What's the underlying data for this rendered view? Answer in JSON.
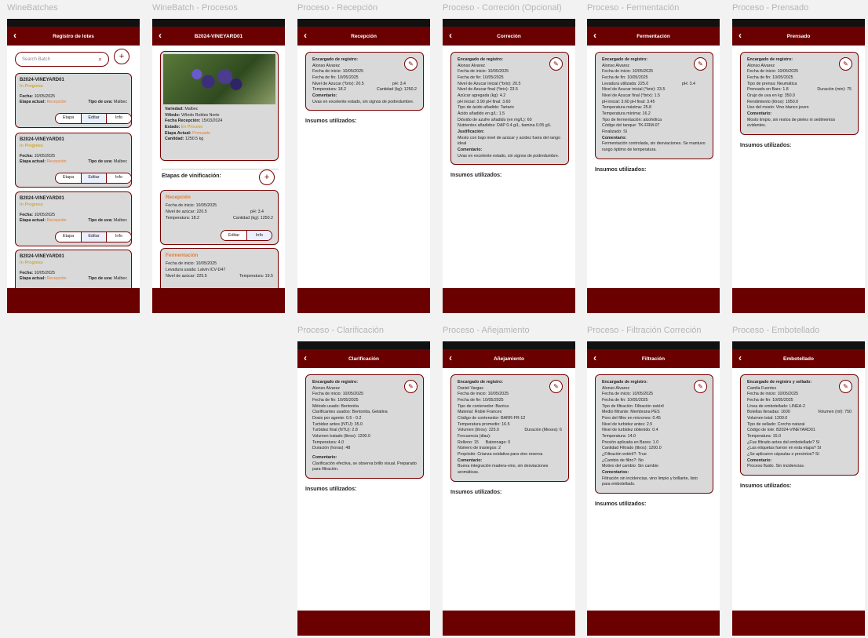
{
  "labels": {
    "l1": "WineBatches",
    "l2": "WineBatch - Procesos",
    "l3": "Proceso - Recepción",
    "l4": "Proceso - Correción (Opcional)",
    "l5": "Proceso - Fermentación",
    "l6": "Proceso - Prensado",
    "l7": "Proceso - Clarificación",
    "l8": "Proceso - Añejamiento",
    "l9": "Proceso - Filtración Correción",
    "l10": "Proceso - Embotellado"
  },
  "batches": {
    "title": "Registro de lotes",
    "search_placeholder": "Search Batch",
    "name": "B2024-VINEYARD01",
    "status": "In Progress",
    "fecha_label": "Fecha:",
    "fecha": "10/05/2025",
    "etapa_label": "Etapa actual:",
    "etapa": "Recepción",
    "uva_label": "Tipo de uva:",
    "uva": "Malbec",
    "btn_etapa": "Etapa",
    "btn_editar": "Editar",
    "btn_info": "Info"
  },
  "procesos": {
    "title": "B2024-VINEYARD01",
    "variedad_l": "Variedad:",
    "variedad": "Malbec",
    "vinedo_l": "Viñedo:",
    "vinedo": "Viñedo Robles Norte",
    "recepcion_l": "Fecha Recepción:",
    "recepcion": "15/03/2024",
    "estado_l": "Estado:",
    "estado": "En Proceso",
    "etapa_l": "Etapa Actual:",
    "etapa": "Prensado",
    "cantidad_l": "Cantidad:",
    "cantidad": "1250.5 kg",
    "etapas_title": "Etapas de vinificación:",
    "rec_title": "Recepción",
    "rec_fecha": "Fecha de inicio: 10/05/2025",
    "rec_azucar": "Nivel de azúcar: 220.5",
    "rec_ph": "pH: 3.4",
    "rec_temp": "Temperatura: 18.2",
    "rec_cant": "Cantidad (kg): 1250.2",
    "btn_editar": "Editar",
    "btn_info": "Info",
    "fer_title": "Fermentación",
    "fer_fecha": "Fecha de inicio: 10/05/2025",
    "fer_lev": "Levadura usada: Lalvin ICV-D47",
    "fer_azucar": "Nivel de azúcar: 225.5",
    "fer_temp": "Temperatura: 19.5"
  },
  "recepcion": {
    "title": "Recepción",
    "lines": [
      "Encargado de registro:",
      "Alonso Alvarez",
      "Fecha de inicio: 10/05/2025",
      "Fecha de fin: 10/05/2025"
    ],
    "azucar": "Nivel de Azucar (°brix): 20.5",
    "ph": "pH: 3.4",
    "temp": "Temperatura: 18.2",
    "cant": "Cantidad (kg): 1250.2",
    "com_l": "Comentario:",
    "com": "Uvas en excelente estado, sin signos de podredumbre.",
    "insumos": "Insumos utilizados:"
  },
  "correcion": {
    "title": "Correción",
    "lines": [
      "Encargado de registro:",
      "Alonso Alvarez",
      "Fecha de inicio: 10/05/2025",
      "Fecha de fin: 10/05/2025",
      "Nivel de Azucar inicial (°brix): 20.5",
      "Nivel de Azucar final (°brix): 23.5",
      "Azúcar agregada (kg): 4.2",
      "pH inicial: 3.90 pH final: 3.60",
      "Tipo de ácido añadido: Tartaric",
      "Ácido añadido en g/L: 1.5",
      "Dióxido de azufre añadido (en mg/L): 60",
      "Nutrientes añadidos: DAP 0.4 g/L, tiamina 0.05 g/L"
    ],
    "just_l": "Justificación:",
    "just": "Mosto con bajo nivel de azúcar y acidez fuera del rango ideal",
    "com_l": "Comentario:",
    "com": "Uvas en excelente estado, sin signos de podredumbre.",
    "insumos": "Insumos utilizados:"
  },
  "fermentacion": {
    "title": "Fermentación",
    "lines": [
      "Encargado de registro:",
      "Alonso Alvarez",
      "Fecha de inicio: 10/05/2025",
      "Fecha de fin: 10/05/2025"
    ],
    "lev": "Levadura utilizada: 225.0",
    "ph": "pH: 3.4",
    "lines2": [
      "Nivel de Azucar inicial (°brix): 23.5",
      "Nivel de Azucar final (°brix): 1.5",
      "pH inicial: 3.60 pH final: 3.45",
      "Temperatura máxima: 25.8",
      "Temperatura mínima: 16.2",
      "Tipo de fermentación: alcohólica",
      "Código del tanque: TK-FRM-07",
      "Finalizado: Sí"
    ],
    "com_l": "Comentario:",
    "com": "Fermentación controlada, sin desviaciones. Se mantuvo rango óptimo de temperatura.",
    "insumos": "Insumos utilizados:"
  },
  "prensado": {
    "title": "Prensado",
    "lines": [
      "Encargado de registro:",
      "Alonso Alvarez",
      "Fecha de inicio: 10/05/2025",
      "Fecha de fin: 10/05/2025",
      "Tipo de prensa: Neumática"
    ],
    "bar": "Prensado en Bars: 1.8",
    "dur": "Duración (min): 75",
    "lines2": [
      "Orujo de uva en kg: 350.0",
      "Rendimiento (litros): 1050.0",
      "Uso del mosto: Vino blanco joven"
    ],
    "com_l": "Comentario:",
    "com": "Mosto limpio, sin restos de pieles ni sedimentos evidentes.",
    "insumos": "Insumos utilizados:"
  },
  "clarificacion": {
    "title": "Clarificación",
    "lines": [
      "Encargado de registro:",
      "Alonso Alvarez",
      "Fecha de inicio: 10/05/2025",
      "Fecha de fin: 10/05/2025",
      "Método usado: Bentonita",
      "Clarificantes usados: Bentonita, Gelatina",
      "Dosis por agente: 0.5 - 0.2",
      "Turbidez antes (NTU): 35.0",
      "Turbidez final (NTU): 2.8",
      "Volumen tratado (litros): 1200.0",
      "Temperatura: 4.0",
      "Duración (horas): 48"
    ],
    "com_l": "Comentario:",
    "com": "Clarificación efectiva, se observa brillo visual. Preparado para filtración.",
    "insumos": "Insumos utilizados:"
  },
  "anejamiento": {
    "title": "Añejamiento",
    "lines": [
      "Encargado de registro:",
      "Daniel Vargas",
      "Fecha de inicio: 10/05/2025",
      "Fecha de fin: 10/05/2025",
      "Tipo de contenedor: Barrica",
      "Material: Roble Frances",
      "Código de contenedor: BARR-FR-12",
      "Temperatura promedio: 16.5"
    ],
    "vol": "Volumen (litros): 225.0",
    "dur": "Duración (Meses): 6",
    "freq": "Frecuencia (dias):",
    "rell": "Relleno: 15",
    "bat": "Batonnage: 0",
    "lines2": [
      "Número de trasiegos: 2",
      "Propósito: Crianza oxidativa para vino reserva"
    ],
    "com_l": "Comentario:",
    "com": "Buena integración madera-vino, sin desviaciones aromáticas.",
    "insumos": "Insumos utilizados:"
  },
  "filtracion": {
    "title": "Filtración",
    "lines": [
      "Encargado de registro:",
      "Alonso Alvarez",
      "Fecha de inicio: 10/05/2025",
      "Fecha de fin: 10/05/2025",
      "Tipo de filtración: Filtración estéril",
      "Medio filtrante: Membrana PES",
      "Poro del filtro en micrones: 0.45",
      "Nivel de turbidez antes: 2.5",
      "Nivel de turbidez obtenido: 0.4",
      "Temperatura: 14.0",
      "Presión aplicada en Bares: 1.0",
      "Cantidad Filtrado (litros): 1200.0",
      "¿Filtración estéril?: True",
      "¿Cambio de filtro?: No",
      "Motivo del cambio: Sin cambio"
    ],
    "com_l": "Comentarios:",
    "com": "Filtración sin incidencias, vino limpio y brillante, listo para embotellado.",
    "insumos": "Insumos utilizados:"
  },
  "embotellado": {
    "title": "Embotellado",
    "lines": [
      "Encargado de registro y sellado:",
      "Camila Fuentes",
      "Fecha de inicio: 10/05/2025",
      "Fecha de fin: 10/05/2025",
      "Línea de embotellado: LINEA-2"
    ],
    "bot": "Botellas llenadas: 1600",
    "vol": "Volumen (ml): 750",
    "lines2": [
      "Volumen total: 1200.0",
      "Tipo de sellado: Corcho natural",
      "Código de lote: B2024-VINEYARD01",
      "Temperatura: 15.0",
      "¿Fue filtrado antes del embotellado? Sí",
      "¿Las etiquetas fueron en esta etapa? Sí",
      "¿Se aplicaron cápsulas o precintos? Sí"
    ],
    "com_l": "Comentario:",
    "com": "Proceso fluido. Sin incidencias.",
    "insumos": "Insumos utilizados:"
  }
}
